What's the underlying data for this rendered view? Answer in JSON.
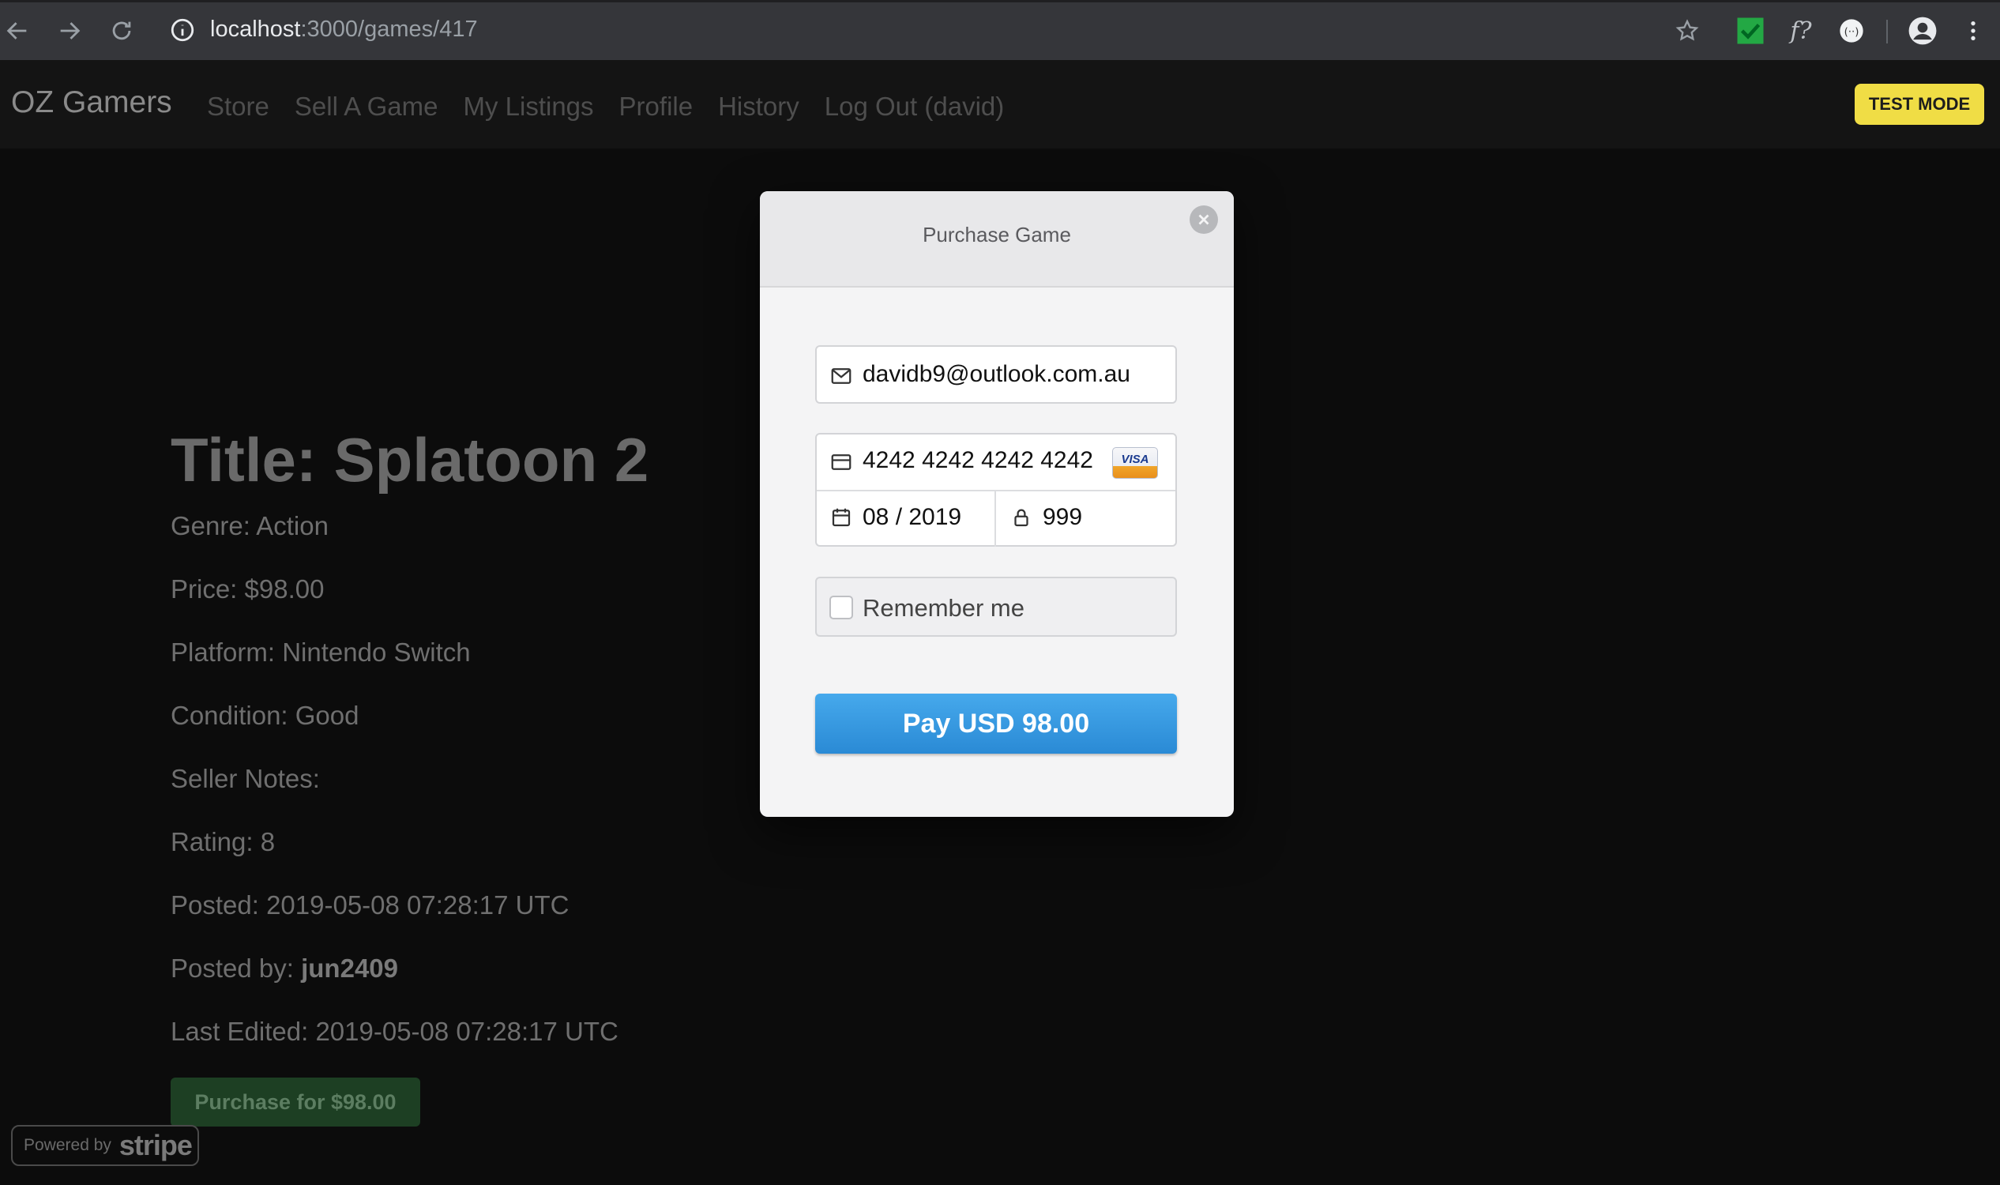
{
  "browser": {
    "url_host": "localhost",
    "url_path": ":3000/games/417"
  },
  "navbar": {
    "brand": "OZ Gamers",
    "links": [
      "Store",
      "Sell A Game",
      "My Listings",
      "Profile",
      "History",
      "Log Out (david)"
    ],
    "test_mode": "TEST MODE"
  },
  "game": {
    "title": "Title: Splatoon 2",
    "genre": "Genre: Action",
    "price": "Price: $98.00",
    "platform": "Platform: Nintendo Switch",
    "condition": "Condition: Good",
    "seller_notes": "Seller Notes:",
    "rating": "Rating: 8",
    "posted": "Posted: 2019-05-08 07:28:17 UTC",
    "posted_by_label": "Posted by: ",
    "posted_by_user": "jun2409",
    "last_edited": "Last Edited: 2019-05-08 07:28:17 UTC",
    "purchase_button": "Purchase for $98.00"
  },
  "powered_by": {
    "label": "Powered by",
    "brand": "stripe"
  },
  "modal": {
    "title": "Purchase Game",
    "email": "davidb9@outlook.com.au",
    "card_number": "4242 4242 4242 4242",
    "card_brand": "VISA",
    "expiry": "08 / 2019",
    "cvc": "999",
    "remember_label": "Remember me",
    "pay_button": "Pay USD 98.00"
  },
  "icons": {
    "back": "back-arrow-icon",
    "forward": "forward-arrow-icon",
    "reload": "reload-icon",
    "info": "info-icon",
    "star": "star-icon",
    "account": "account-icon",
    "menu": "kebab-menu-icon"
  },
  "colors": {
    "test_mode_bg": "#f0dd45",
    "pay_button": "#2a8ad5",
    "purchase_button": "#1d3f23"
  }
}
